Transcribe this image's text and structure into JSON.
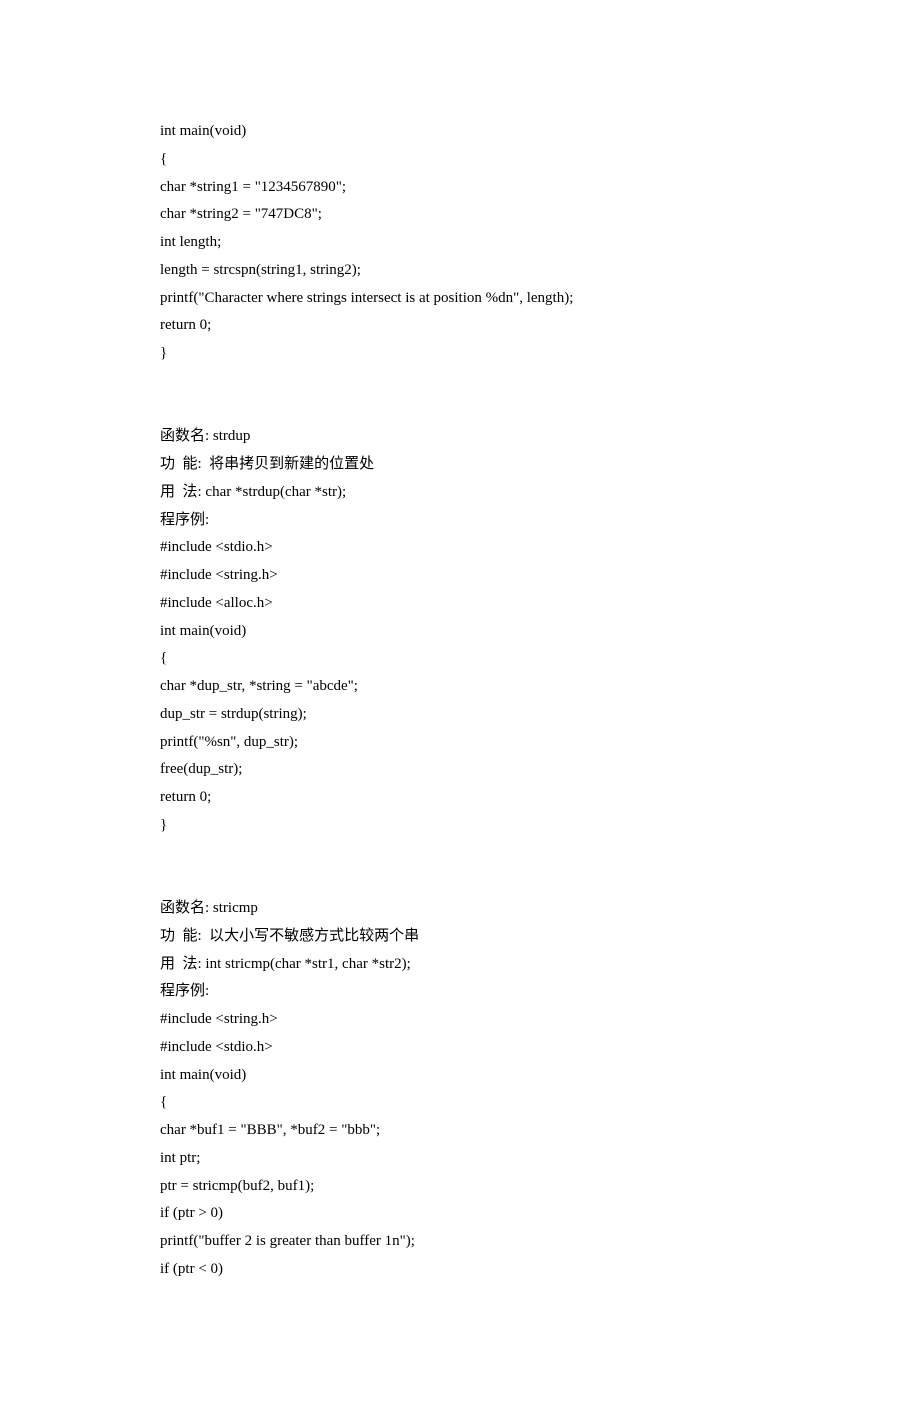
{
  "lines": [
    "int main(void)",
    "{",
    "char *string1 = \"1234567890\";",
    "char *string2 = \"747DC8\";",
    "int length;",
    "length = strcspn(string1, string2);",
    "printf(\"Character where strings intersect is at position %dn\", length);",
    "return 0;",
    "}",
    "",
    "",
    "函数名: strdup",
    "功  能:  将串拷贝到新建的位置处",
    "用  法: char *strdup(char *str);",
    "程序例:",
    "#include <stdio.h>",
    "#include <string.h>",
    "#include <alloc.h>",
    "int main(void)",
    "{",
    "char *dup_str, *string = \"abcde\";",
    "dup_str = strdup(string);",
    "printf(\"%sn\", dup_str);",
    "free(dup_str);",
    "return 0;",
    "}",
    "",
    "",
    "函数名: stricmp",
    "功  能:  以大小写不敏感方式比较两个串",
    "用  法: int stricmp(char *str1, char *str2);",
    "程序例:",
    "#include <string.h>",
    "#include <stdio.h>",
    "int main(void)",
    "{",
    "char *buf1 = \"BBB\", *buf2 = \"bbb\";",
    "int ptr;",
    "ptr = stricmp(buf2, buf1);",
    "if (ptr > 0)",
    "printf(\"buffer 2 is greater than buffer 1n\");",
    "if (ptr < 0)"
  ]
}
